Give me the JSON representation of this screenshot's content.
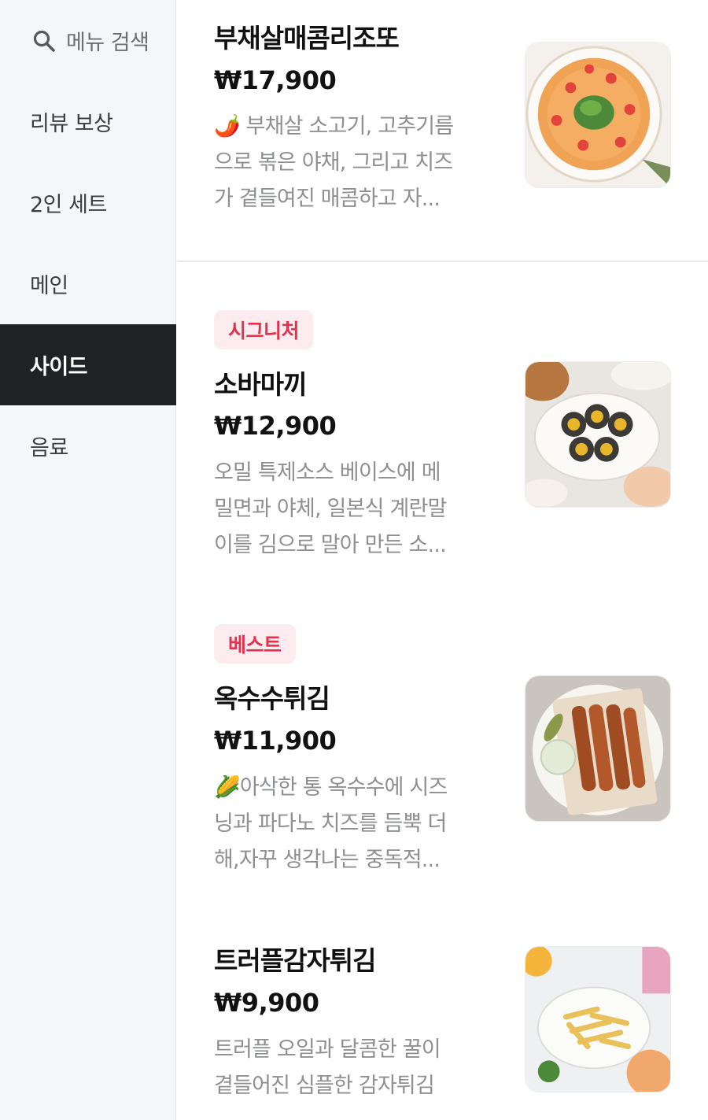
{
  "sidebar": {
    "search_label": "메뉴 검색",
    "items": [
      {
        "label": "리뷰 보상"
      },
      {
        "label": "2인 세트"
      },
      {
        "label": "메인"
      },
      {
        "label": "사이드",
        "active": true
      },
      {
        "label": "음료"
      }
    ]
  },
  "menu": [
    {
      "name": "부채살매콤리조또",
      "price": "₩17,900",
      "description_lines": [
        "🌶️ 부채살 소고기, 고추기름",
        "으로 볶은 야채, 그리고 치즈",
        "가 곁들여진 매콤하고 자..."
      ],
      "image_icon": "risotto-photo"
    },
    {
      "badge": "시그니처",
      "name": "소바마끼",
      "price": "₩12,900",
      "description_lines": [
        "오밀 특제소스 베이스에 메",
        "밀면과 야체, 일본식 계란말",
        "이를 김으로 말아 만든 소..."
      ],
      "image_icon": "soba-maki-photo"
    },
    {
      "badge": "베스트",
      "name": "옥수수튀김",
      "price": "₩11,900",
      "description_lines": [
        "🌽아삭한 통 옥수수에 시즈",
        "닝과 파다노 치즈를 듬뿍 더",
        "해,자꾸 생각나는 중독적..."
      ],
      "image_icon": "fried-corn-photo"
    },
    {
      "name": "트러플감자튀김",
      "price": "₩9,900",
      "description_lines": [
        "트러플 오일과 달콤한 꿀이",
        "곁들어진 심플한 감자튀김"
      ],
      "image_icon": "truffle-fries-photo"
    }
  ],
  "colors": {
    "sidebar_bg": "#f5f6f8",
    "active_bg": "#202124",
    "badge_bg": "#fdecef",
    "badge_text": "#e2324e",
    "desc_text": "#8d8f93"
  }
}
